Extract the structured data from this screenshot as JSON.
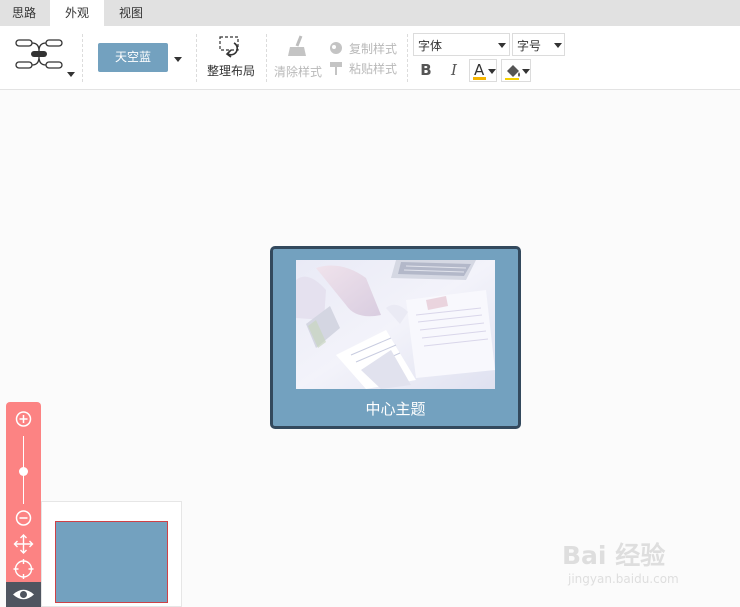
{
  "tabs": [
    {
      "label": "思路"
    },
    {
      "label": "外观"
    },
    {
      "label": "视图"
    }
  ],
  "toolbar": {
    "theme_label": "天空蓝",
    "layout_label": "整理布局",
    "clear_style_label": "清除样式",
    "copy_style_label": "复制样式",
    "paste_style_label": "粘贴样式",
    "font_placeholder": "字体",
    "font_size_placeholder": "字号",
    "bold_label": "B",
    "italic_label": "I",
    "font_color_label": "A",
    "font_color": "#f5b400",
    "theme_color": "#73a1bf"
  },
  "canvas": {
    "central_topic": {
      "title": "中心主题",
      "fill_color": "#73a1bf",
      "border_color": "#33495d"
    }
  },
  "zoom_controls": {
    "icons": [
      "zoom-in-icon",
      "zoom-out-icon",
      "move-icon",
      "locate-icon",
      "eye-icon"
    ],
    "accent_color": "#fc8383"
  },
  "watermark": {
    "main": "Bai 经验",
    "sub": "jingyan.baidu.com"
  }
}
